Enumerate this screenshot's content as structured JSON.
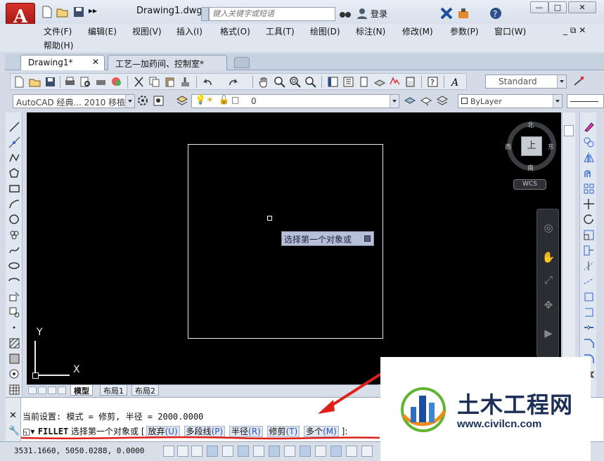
{
  "window": {
    "title": "Drawing1.dwg",
    "search_placeholder": "键入关键字或短语",
    "login_label": "登录",
    "min_label": "—",
    "max_label": "□",
    "close_label": "✕"
  },
  "menu": {
    "items": [
      "文件(F)",
      "编辑(E)",
      "视图(V)",
      "插入(I)",
      "格式(O)",
      "工具(T)",
      "绘图(D)",
      "标注(N)",
      "修改(M)",
      "参数(P)",
      "窗口(W)"
    ],
    "help": "帮助(H)",
    "mdi_controls": "_ ⧉ ✕"
  },
  "tabs": [
    {
      "label": "Drawing1*",
      "active": true
    },
    {
      "label": "工艺—加药间、控制室*",
      "active": false
    }
  ],
  "toolbar": {
    "textstyle": "Standard",
    "workspace": "AutoCAD 经典... 2010 移植",
    "layer": "0",
    "linetype": "ByLayer"
  },
  "canvas": {
    "tooltip": "选择第一个对象或",
    "compass": {
      "n": "北",
      "s": "南",
      "e": "东",
      "w": "西",
      "top": "上"
    },
    "wcs": "WCS",
    "ucs_x": "X",
    "ucs_y": "Y"
  },
  "layout_tabs": [
    "模型",
    "布局1",
    "布局2"
  ],
  "command": {
    "history": "当前设置: 模式 = 修剪, 半径 = 2000.0000",
    "prompt_cmd": "FILLET",
    "prompt_text": "选择第一个对象或",
    "options": [
      {
        "pre": "[",
        "label": "放弃",
        "key": "(U)"
      },
      {
        "pre": "",
        "label": "多段线",
        "key": "(P)"
      },
      {
        "pre": "",
        "label": "半径",
        "key": "(R)"
      },
      {
        "pre": "",
        "label": "修剪",
        "key": "(T)"
      },
      {
        "pre": "",
        "label": "多个",
        "key": "(M)"
      }
    ],
    "trail": "]:"
  },
  "status": {
    "coords": "3531.1660,  5050.0288,  0.0000"
  },
  "watermark": {
    "name": "土木工程网",
    "url": "www.civilcn.com"
  },
  "colors": {
    "canvas_bg": "#000000",
    "accent_red": "#e0201a",
    "brand_blue": "#1b2f57"
  }
}
